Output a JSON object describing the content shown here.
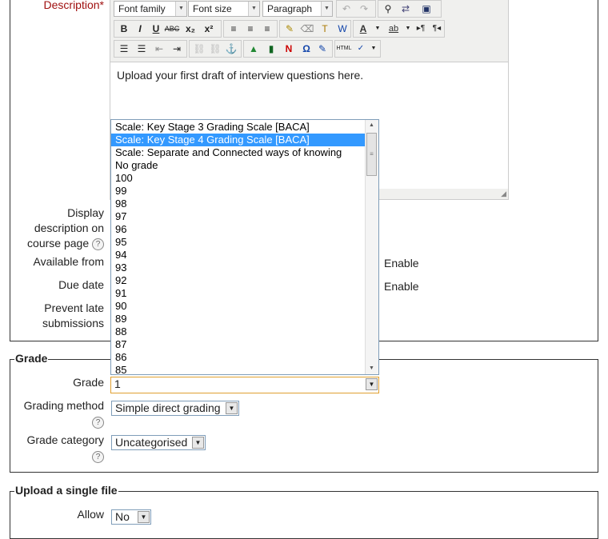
{
  "general": {
    "description_label": "Description",
    "required_mark": "*",
    "editor": {
      "font_family": "Font family",
      "font_size": "Font size",
      "format": "Paragraph",
      "content": "Upload your first draft of interview questions here."
    },
    "display_desc_label_1": "Display",
    "display_desc_label_2": "description on",
    "display_desc_label_3": "course page",
    "available_from_label": "Available from",
    "available_from_enable": "Enable",
    "due_date_label": "Due date",
    "due_date_enable": "Enable",
    "prevent_late_label_1": "Prevent late",
    "prevent_late_label_2": "submissions"
  },
  "grade_section": {
    "legend": "Grade",
    "grade_label": "Grade",
    "grade_value": "1",
    "grade_options": [
      "Scale: Key Stage 3 Grading Scale [BACA]",
      "Scale: Key Stage 4 Grading Scale [BACA]",
      "Scale: Separate and Connected ways of knowing",
      "No grade",
      "100",
      "99",
      "98",
      "97",
      "96",
      "95",
      "94",
      "93",
      "92",
      "91",
      "90",
      "89",
      "88",
      "87",
      "86",
      "85"
    ],
    "selected_option_index": 1,
    "grading_method_label": "Grading method",
    "grading_method_value": "Simple direct grading",
    "grade_category_label": "Grade category",
    "grade_category_value": "Uncategorised"
  },
  "upload_section": {
    "legend": "Upload a single file",
    "allow_label": "Allow",
    "allow_value": "No"
  },
  "icons": {
    "help": "question-circle-icon",
    "dropdown": "chevron-down-icon"
  },
  "colors": {
    "required": "#a01010",
    "selection": "#3399ff"
  }
}
